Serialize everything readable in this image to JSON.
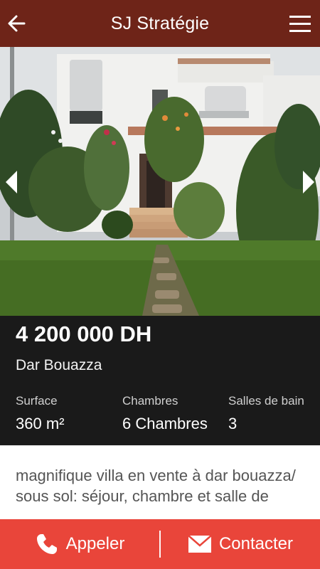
{
  "app": {
    "title": "SJ Stratégie"
  },
  "property": {
    "price": "4 200 000 DH",
    "location": "Dar Bouazza",
    "features": [
      {
        "label": "Surface",
        "value": "360 m²"
      },
      {
        "label": "Chambres",
        "value": "6 Chambres"
      },
      {
        "label": "Salles de bain",
        "value": "3"
      }
    ],
    "description": "magnifique villa en vente à dar bouazza/ sous sol: séjour, chambre et salle de"
  },
  "actions": {
    "call_label": "Appeler",
    "contact_label": "Contacter"
  },
  "colors": {
    "appbar": "#6e2418",
    "info_panel": "#1a1a1a",
    "action_bar": "#e9453a"
  },
  "icons": {
    "back": "arrow-left-icon",
    "menu": "hamburger-menu-icon",
    "prev": "chevron-left-icon",
    "next": "chevron-right-icon",
    "call": "phone-icon",
    "contact": "envelope-icon"
  }
}
